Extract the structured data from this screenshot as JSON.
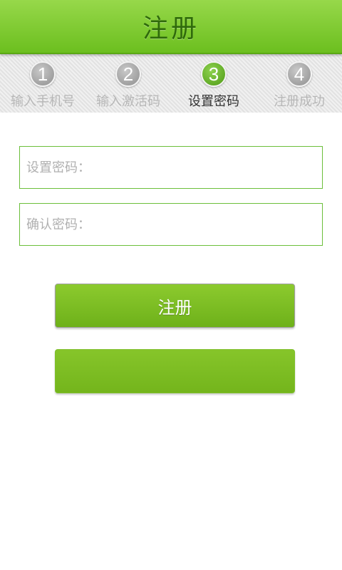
{
  "header": {
    "title": "注册"
  },
  "steps": [
    {
      "number": "1",
      "label": "输入手机号"
    },
    {
      "number": "2",
      "label": "输入激活码"
    },
    {
      "number": "3",
      "label": "设置密码"
    },
    {
      "number": "4",
      "label": "注册成功"
    }
  ],
  "active_step": 3,
  "form": {
    "password": {
      "placeholder": "设置密码：",
      "value": ""
    },
    "confirm": {
      "placeholder": "确认密码：",
      "value": ""
    }
  },
  "buttons": {
    "register_label": "注册",
    "secondary_label": ""
  },
  "colors": {
    "accent": "#7cbd23",
    "header_title": "#2f6a0b",
    "step_inactive": "#b7b7b7",
    "step_active_text": "#333333"
  }
}
